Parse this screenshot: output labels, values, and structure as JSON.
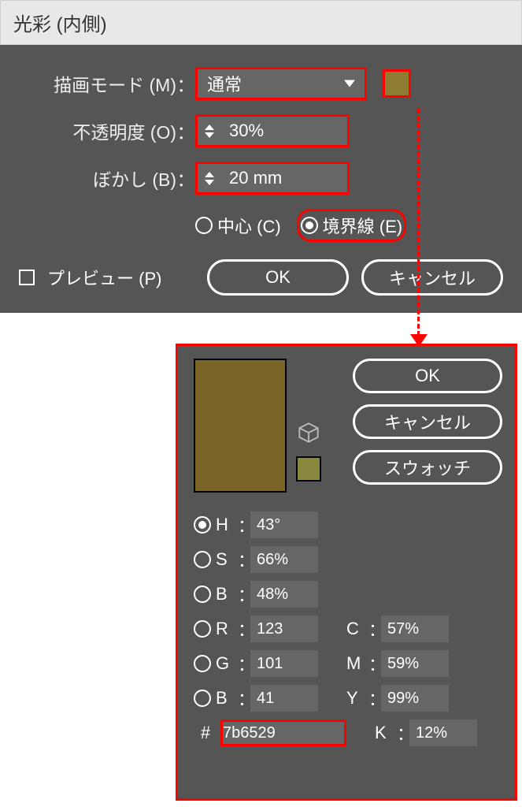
{
  "dialog1": {
    "title": "光彩 (内側)",
    "mode_label": "描画モード (M)",
    "mode_value": "通常",
    "opacity_label": "不透明度 (O)",
    "opacity_value": "30%",
    "blur_label": "ぼかし (B)",
    "blur_value": "20 mm",
    "center_label": "中心 (C)",
    "edge_label": "境界線 (E)",
    "preview_label": "プレビュー (P)",
    "ok_label": "OK",
    "cancel_label": "キャンセル",
    "swatch_color": "#8f7c33"
  },
  "dialog2": {
    "ok_label": "OK",
    "cancel_label": "キャンセル",
    "swatch_label": "スウォッチ",
    "big_swatch_color": "#7b6529",
    "mini_swatch_color": "#8a873f",
    "h_label": "H",
    "s_label": "S",
    "b_label": "B",
    "r_label": "R",
    "g_label": "G",
    "b2_label": "B",
    "c_label": "C",
    "m_label": "M",
    "y_label": "Y",
    "k_label": "K",
    "h_value": "43°",
    "s_value": "66%",
    "b_value": "48%",
    "r_value": "123",
    "g_value": "101",
    "b2_value": "41",
    "c_value": "57%",
    "m_value": "59%",
    "y_value": "99%",
    "k_value": "12%",
    "hex_value": "7b6529"
  }
}
